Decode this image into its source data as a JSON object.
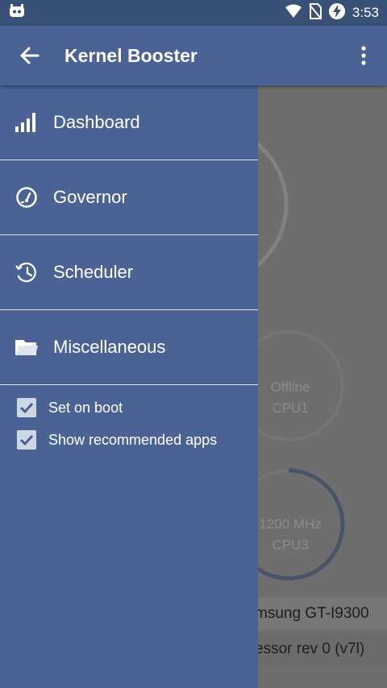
{
  "status_bar": {
    "time": "3:53"
  },
  "toolbar": {
    "title": "Kernel Booster"
  },
  "drawer": {
    "items": [
      {
        "label": "Dashboard",
        "icon": "signal-bars-icon"
      },
      {
        "label": "Governor",
        "icon": "gauge-icon"
      },
      {
        "label": "Scheduler",
        "icon": "clock-history-icon"
      },
      {
        "label": "Miscellaneous",
        "icon": "folder-icon"
      }
    ],
    "checkboxes": [
      {
        "label": "Set on boot",
        "checked": true
      },
      {
        "label": "Show recommended apps",
        "checked": true
      }
    ]
  },
  "background": {
    "cpu1": {
      "value": "Offline",
      "name": "CPU1"
    },
    "cpu3": {
      "value": "1200 MHz",
      "name": "CPU3"
    },
    "device": "msung GT-I9300",
    "processor": "essor rev 0 (v7l)"
  },
  "colors": {
    "primary": "#4a6294",
    "primary_dark": "#3a5177",
    "scrim": "#6e6e6e"
  }
}
